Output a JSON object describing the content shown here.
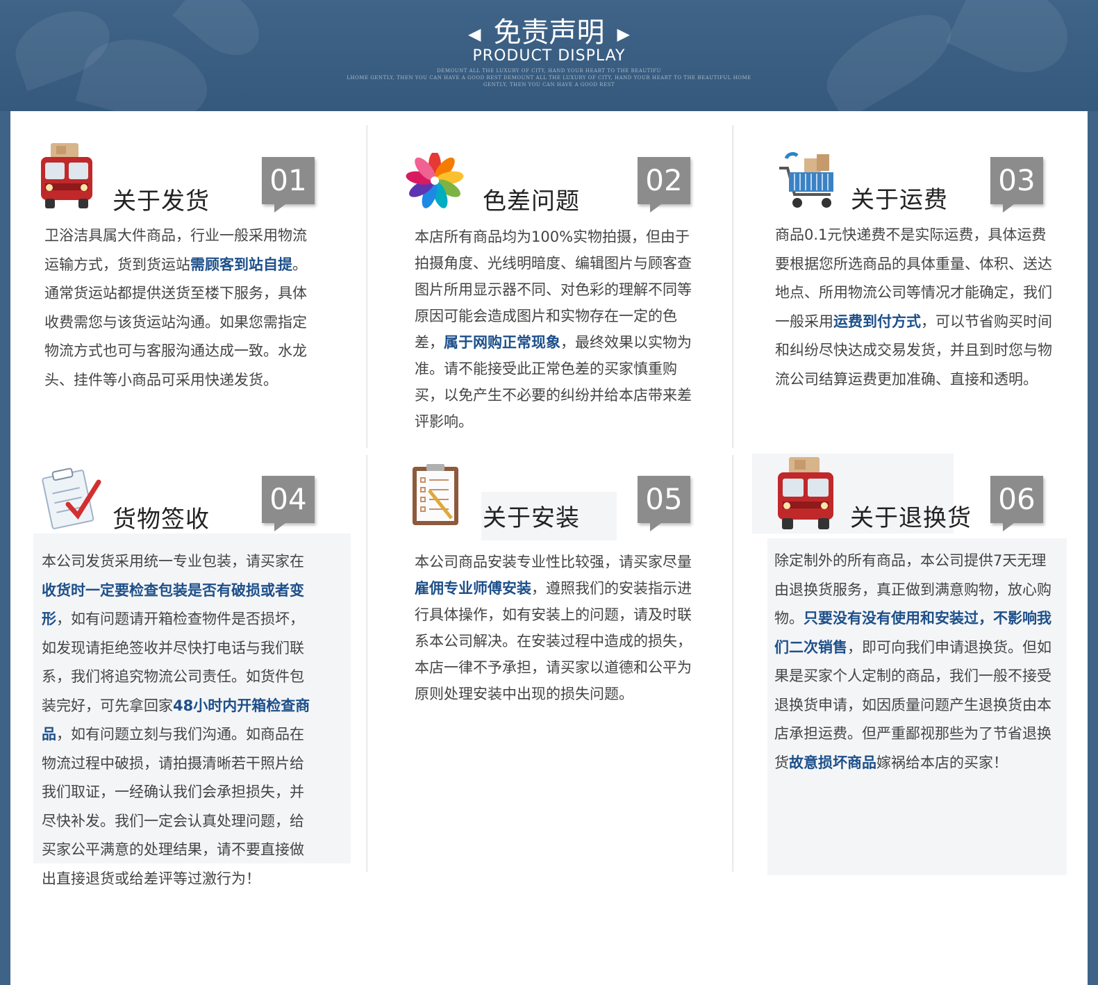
{
  "header": {
    "title": "免责声明",
    "subtitle": "PRODUCT DISPLAY",
    "fine_print": [
      "DEMOUNT ALL THE LUXURY OF CITY, HAND YOUR HEART TO THE BEAUTIFU",
      "LHOME GENTLY, THEN YOU CAN HAVE A GOOD REST DEMOUNT ALL THE LUXURY OF CITY, HAND YOUR HEART TO THE BEAUTIFUL HOME",
      "GENTLY, THEN YOU CAN HAVE A GOOD REST"
    ]
  },
  "colors": {
    "header_bg": "#3e6387",
    "highlight": "#1d4f8a",
    "tab_bg": "#8c8c8c"
  },
  "sections": [
    {
      "number": "01",
      "title": "关于发货",
      "icon": "delivery-truck-icon",
      "segments": [
        {
          "t": "卫浴洁具属大件商品，行业一般采用物流运输方式，货到货运站"
        },
        {
          "t": "需顾客到站自提",
          "h": true
        },
        {
          "t": "。通常货运站都提供送货至楼下服务，具体收费需您与该货运站沟通。如果您需指定物流方式也可与客服沟通达成一致。水龙头、挂件等小商品可采用快递发货。"
        }
      ]
    },
    {
      "number": "02",
      "title": "色差问题",
      "icon": "color-wheel-icon",
      "segments": [
        {
          "t": "本店所有商品均为100%实物拍摄，但由于拍摄角度、光线明暗度、编辑图片与顾客查图片所用显示器不同、对色彩的理解不同等原因可能会造成图片和实物存在一定的色差，"
        },
        {
          "t": "属于网购正常现象",
          "h": true
        },
        {
          "t": "，最终效果以实物为准。请不能接受此正常色差的买家慎重购买，以免产生不必要的纠纷并给本店带来差评影响。"
        }
      ]
    },
    {
      "number": "03",
      "title": "关于运费",
      "icon": "shopping-cart-icon",
      "segments": [
        {
          "t": "商品0.1元快递费不是实际运费，具体运费要根据您所选商品的具体重量、体积、送达地点、所用物流公司等情况才能确定，我们一般采用"
        },
        {
          "t": "运费到付方式",
          "h": true
        },
        {
          "t": "，可以节省购买时间和纠纷尽快达成交易发货，并且到时您与物流公司结算运费更加准确、直接和透明。"
        }
      ]
    },
    {
      "number": "04",
      "title": "货物签收",
      "icon": "checklist-icon",
      "segments": [
        {
          "t": "本公司发货采用统一专业包装，请买家在"
        },
        {
          "t": "收货时一定要检查包装是否有破损或者变形",
          "h": true
        },
        {
          "t": "，如有问题请开箱检查物件是否损坏，如发现请拒绝签收并尽快打电话与我们联系，我们将追究物流公司责任。如货件包装完好，可先拿回家"
        },
        {
          "t": "48小时内开箱检查商品",
          "h": true
        },
        {
          "t": "，如有问题立刻与我们沟通。如商品在物流过程中破损，请拍摄清晰若干照片给我们取证，一经确认我们会承担损失，并尽快补发。我们一定会认真处理问题，给买家公平满意的处理结果，请不要直接做出直接退货或给差评等过激行为！"
        }
      ]
    },
    {
      "number": "05",
      "title": "关于安装",
      "icon": "clipboard-icon",
      "segments": [
        {
          "t": "本公司商品安装专业性比较强，请买家尽量"
        },
        {
          "t": "雇佣专业师傅安装",
          "h": true
        },
        {
          "t": "，遵照我们的安装指示进行具体操作，如有安装上的问题，请及时联系本公司解决。在安装过程中造成的损失，本店一律不予承担，请买家以道德和公平为原则处理安装中出现的损失问题。"
        }
      ]
    },
    {
      "number": "06",
      "title": "关于退换货",
      "icon": "delivery-truck-icon",
      "segments": [
        {
          "t": "除定制外的所有商品，本公司提供7天无理由退换货服务，真正做到满意购物，放心购物。"
        },
        {
          "t": "只要没有没有使用和安装过，不影响我们二次销售",
          "h": true
        },
        {
          "t": "，即可向我们申请退换货。但如果是买家个人定制的商品，我们一般不接受退换货申请，如因质量问题产生退换货由本店承担运费。但严重鄙视那些为了节省退换货"
        },
        {
          "t": "故意损坏商品",
          "h": true
        },
        {
          "t": "嫁祸给本店的买家！"
        }
      ]
    }
  ]
}
